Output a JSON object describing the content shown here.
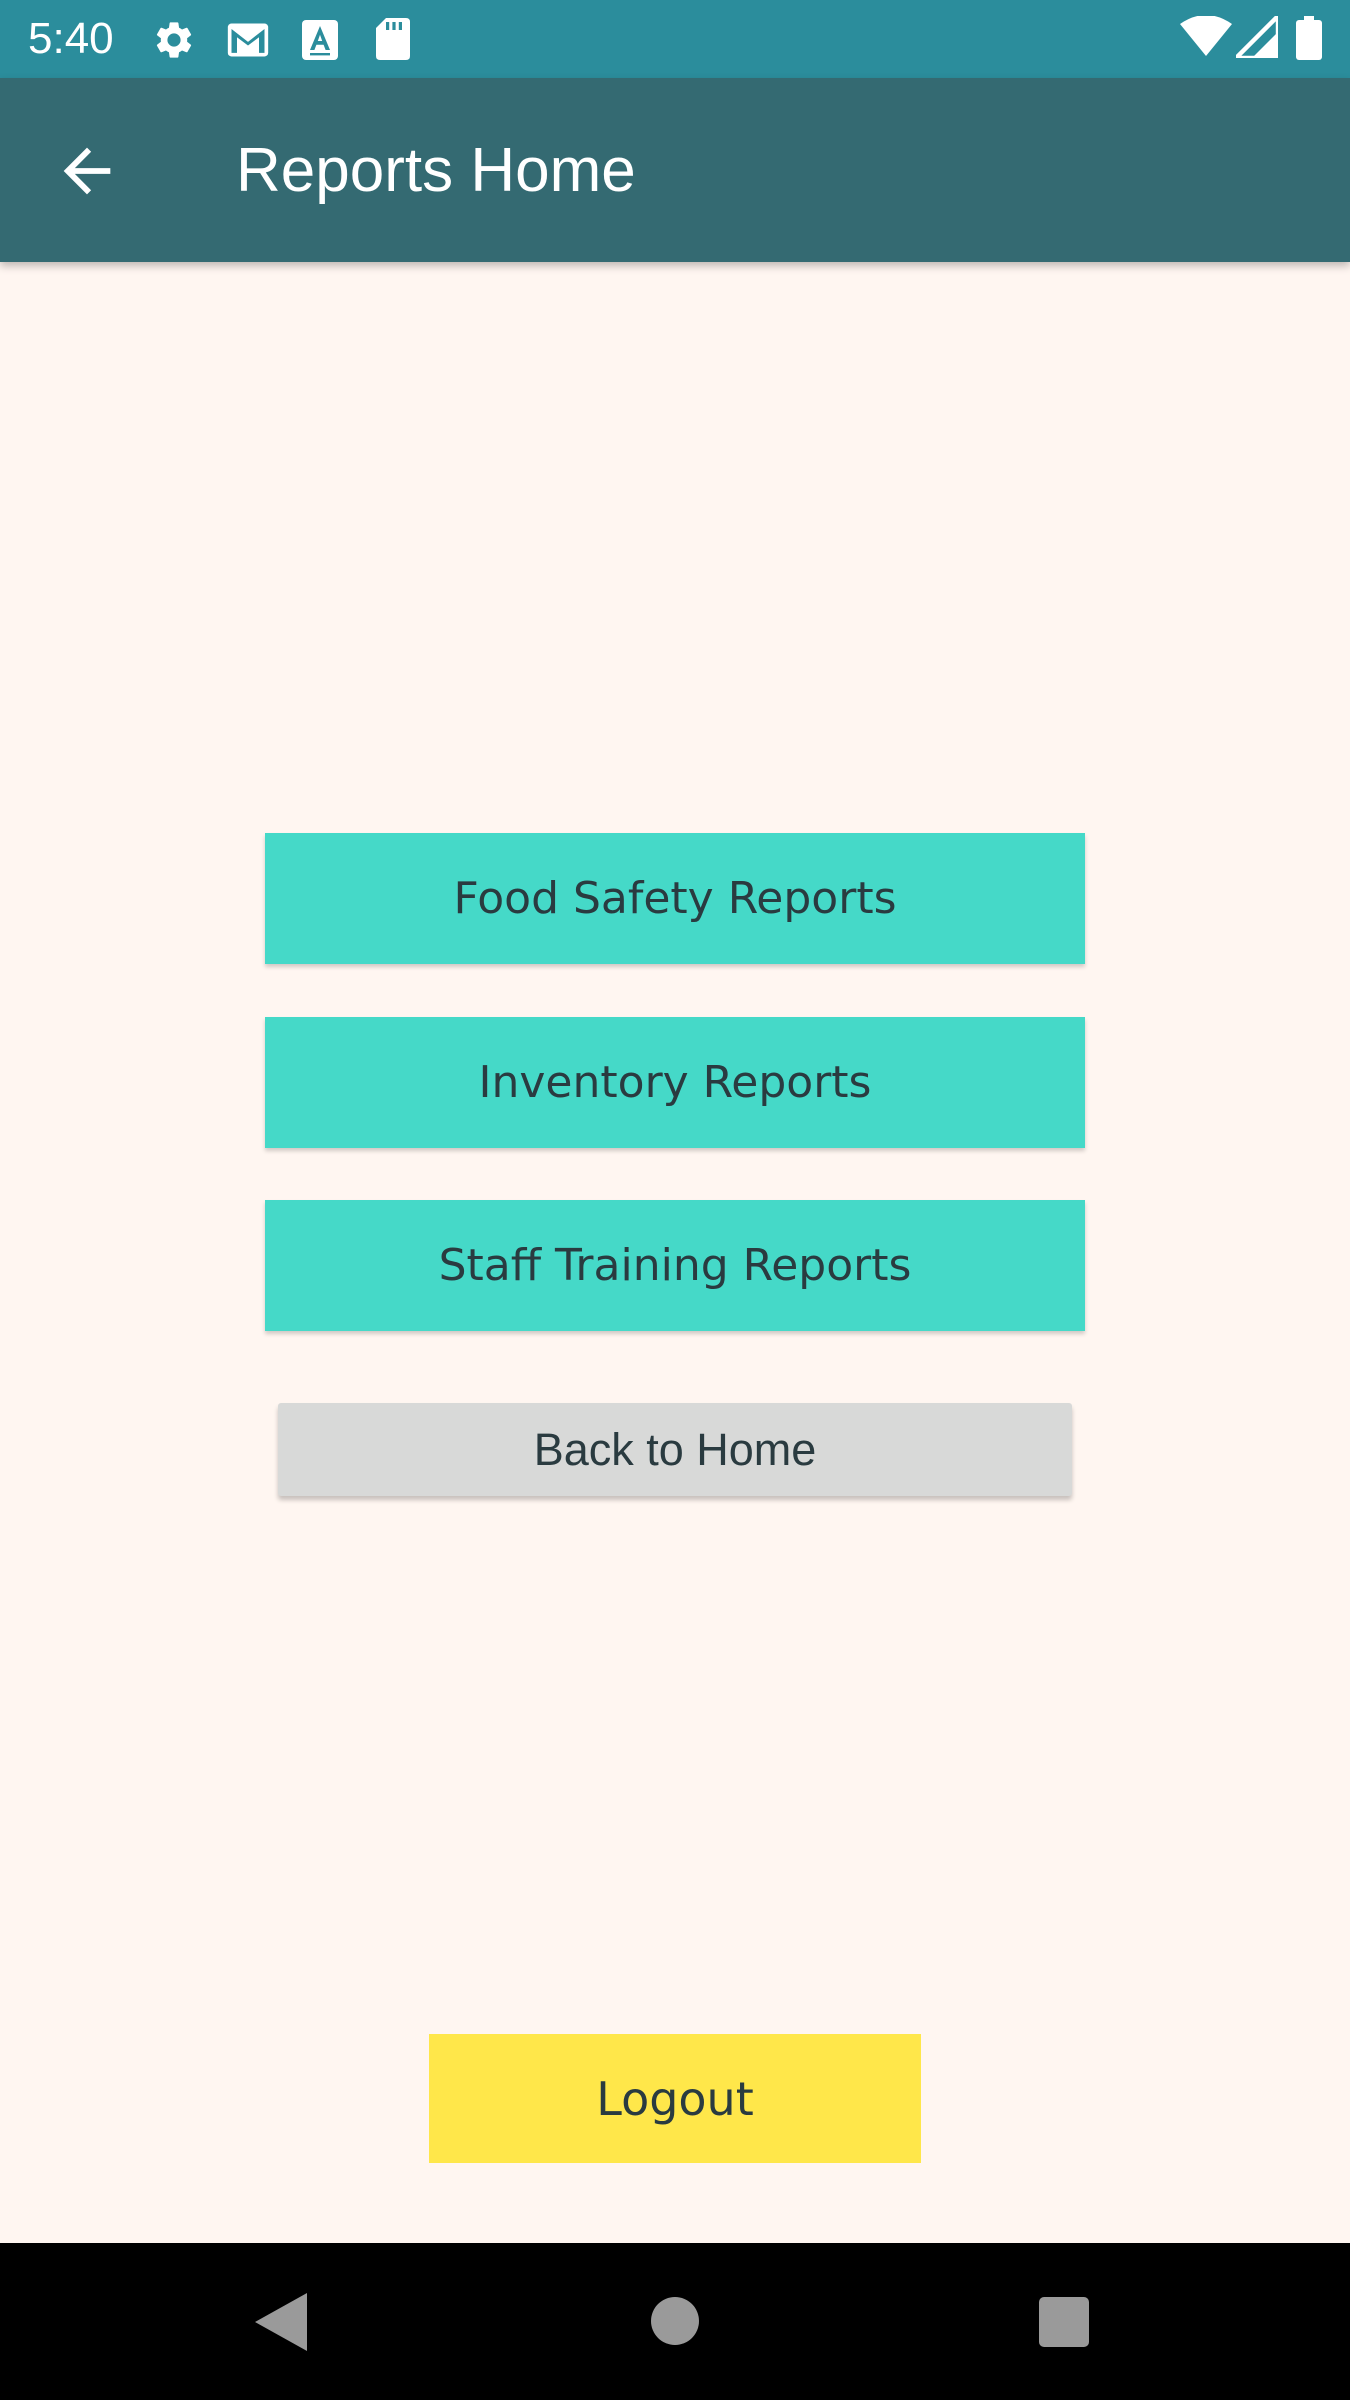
{
  "status_bar": {
    "time": "5:40",
    "left_icons": [
      "gear-icon",
      "gmail-icon",
      "a-font-icon",
      "sd-card-icon"
    ],
    "right_icons": [
      "wifi-icon",
      "cell-signal-icon",
      "battery-icon"
    ]
  },
  "app_bar": {
    "title": "Reports Home",
    "back_icon": "back-arrow-icon"
  },
  "buttons": {
    "food_safety": "Food Safety Reports",
    "inventory": "Inventory Reports",
    "staff_training": "Staff Training Reports",
    "back_home": "Back to Home",
    "logout": "Logout"
  },
  "nav_bar": {
    "icons": [
      "nav-back-icon",
      "nav-home-icon",
      "nav-recents-icon"
    ]
  },
  "colors": {
    "status_bar": "#2b8d9c",
    "app_bar": "#346a72",
    "background": "#fff6f1",
    "teal_button": "#45d9c8",
    "grey_button": "#d8d9d8",
    "logout_button": "#ffe74a"
  }
}
